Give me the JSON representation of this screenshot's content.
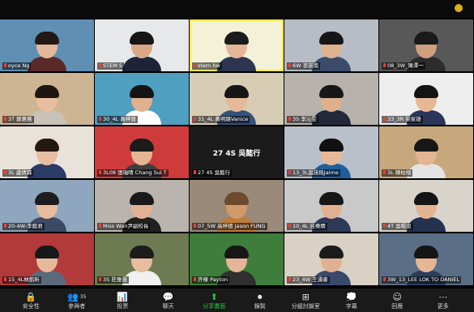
{
  "tiles": [
    {
      "name": "oyce Ng",
      "bg": "#5f8fb3",
      "skin": "#e2b79a",
      "hair": "#241814",
      "body": "#5a2a2a"
    },
    {
      "name": "STEM 5",
      "bg": "#e6e8ea",
      "skin": "#d8a886",
      "hair": "#151515",
      "body": "#1d2438"
    },
    {
      "name": "stem hw",
      "bg": "#f3f1d6",
      "skin": "#e4b696",
      "hair": "#1c1c1c",
      "body": "#2d3650",
      "speaking": true
    },
    {
      "name": "6W 李諾南",
      "bg": "#b8bcc4",
      "skin": "#e0b28f",
      "hair": "#161616",
      "body": "#3c4b6a"
    },
    {
      "name": "08_3W_陳澤一",
      "bg": "#585858",
      "skin": "#cf9f7e",
      "hair": "#1a1a1a",
      "body": "#2c2c2c"
    },
    {
      "name": "3T 鄭蕙蕎",
      "bg": "#cdb493",
      "skin": "#e8bea0",
      "hair": "#1f1611",
      "body": "#c8c2b6"
    },
    {
      "name": "30_4L 黃梓晉",
      "bg": "#4f9fc1",
      "skin": "#e2b08d",
      "hair": "#141414",
      "body": "#ffffff"
    },
    {
      "name": "31_4L 黃明璐Vanice",
      "bg": "#d7cdb5",
      "skin": "#e6b99a",
      "hair": "#161616",
      "body": "#36527a"
    },
    {
      "name": "3S 李沁雯",
      "bg": "#b7b3ac",
      "skin": "#dfb08c",
      "hair": "#181818",
      "body": "#23283a"
    },
    {
      "name": "33_3R 梁家雄",
      "bg": "#eeeeee",
      "skin": "#e7b896",
      "hair": "#131313",
      "body": "#2b355a"
    },
    {
      "name": "3L 盧倩霖",
      "bg": "#e8e2da",
      "skin": "#e6bda0",
      "hair": "#241915",
      "body": "#2b3b66"
    },
    {
      "name": "3L08 張瑞晴 Chang Sui T",
      "bg": "#cf3b3b",
      "skin": "#e6b594",
      "hair": "#1b1b1b",
      "body": "#3e3e3e"
    },
    {
      "name": "27 4S 吳懿行",
      "bg": "#1b1b1b",
      "plain": true,
      "center": "27 4S 吳懿行"
    },
    {
      "name": "13_3L吳諾銘Jaime",
      "bg": "#b9c0c9",
      "skin": "#e6b898",
      "hair": "#101010",
      "body": "#1f5e9c"
    },
    {
      "name": "3L 陳柏翔",
      "bg": "#c7a87c",
      "skin": "#e5b493",
      "hair": "#171717",
      "body": "#e3e3e3"
    },
    {
      "name": "20-4W-李懿君",
      "bg": "#8fa7be",
      "skin": "#e8bc9c",
      "hair": "#1d1d1d",
      "body": "#3d4a63"
    },
    {
      "name": "Miss Wan尹副校長",
      "bg": "#b9b4ae",
      "skin": "#e3b294",
      "hair": "#1a1a1a",
      "body": "#202020"
    },
    {
      "name": "07_5W 高梓德 Jason FUNG",
      "bg": "#9a8a7a",
      "skin": "#d19a6a",
      "hair": "#6b4a2e",
      "body": "#c07a3a"
    },
    {
      "name": "10_4L 呂樂睛",
      "bg": "#c9c9c9",
      "skin": "#e2b091",
      "hair": "#161616",
      "body": "#2e3a55"
    },
    {
      "name": "4T 吳暘浚",
      "bg": "#d8d4cc",
      "skin": "#e4b392",
      "hair": "#151515",
      "body": "#24324f"
    },
    {
      "name": "15_4L林凱昕",
      "bg": "#b33a3a",
      "skin": "#e6b99b",
      "hair": "#181818",
      "body": "#5b6a7a"
    },
    {
      "name": "3S 莊雅喬",
      "bg": "#6e7b52",
      "skin": "#e8bd9f",
      "hair": "#1c1c1c",
      "body": "#f0f0f0"
    },
    {
      "name": "許楝 Payton",
      "bg": "#3e7d3b",
      "skin": "#e4b596",
      "hair": "#171717",
      "body": "#2f2f2f"
    },
    {
      "name": "23_4W 王湧睿",
      "bg": "#d9d1c3",
      "skin": "#e2b08e",
      "hair": "#1b1b1b",
      "body": "#3a4a6d"
    },
    {
      "name": "3W_13_LEE LOK TO DANIEL",
      "bg": "#5a6f86",
      "skin": "#e6b696",
      "hair": "#151515",
      "body": "#2c3d5c"
    }
  ],
  "toolbar": {
    "items": [
      {
        "icon": "🔒",
        "label": "安全性"
      },
      {
        "icon": "👥",
        "label": "參與者",
        "count": "35"
      },
      {
        "icon": "📊",
        "label": "投票"
      },
      {
        "icon": "💬",
        "label": "聊天"
      },
      {
        "icon": "⬆",
        "label": "分享畫面",
        "share": true
      },
      {
        "icon": "⏺",
        "label": "錄製"
      },
      {
        "icon": "⊞",
        "label": "分組討論室"
      },
      {
        "icon": "💭",
        "label": "字幕"
      },
      {
        "icon": "☺",
        "label": "回應"
      },
      {
        "icon": "⋯",
        "label": "更多"
      }
    ]
  }
}
